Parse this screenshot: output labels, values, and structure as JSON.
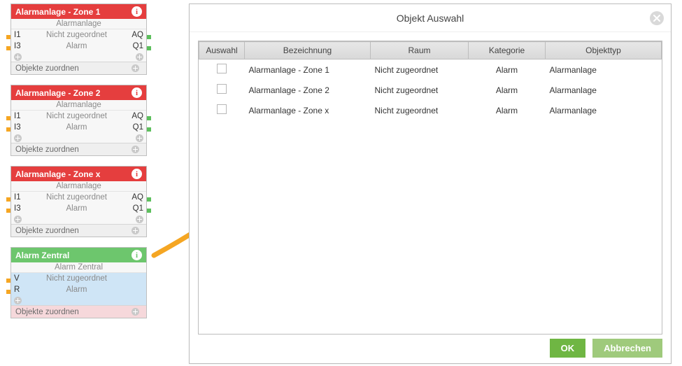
{
  "cards": [
    {
      "variant": "red",
      "title": "Alarmanlage - Zone 1",
      "subtype": "Alarmanlage",
      "rows": [
        {
          "l": "I1",
          "mid": "Nicht zugeordnet",
          "r": "AQ"
        },
        {
          "l": "I3",
          "mid": "Alarm",
          "r": "Q1"
        }
      ],
      "footer": "Objekte zuordnen"
    },
    {
      "variant": "red",
      "title": "Alarmanlage - Zone 2",
      "subtype": "Alarmanlage",
      "rows": [
        {
          "l": "I1",
          "mid": "Nicht zugeordnet",
          "r": "AQ"
        },
        {
          "l": "I3",
          "mid": "Alarm",
          "r": "Q1"
        }
      ],
      "footer": "Objekte zuordnen"
    },
    {
      "variant": "red",
      "title": "Alarmanlage - Zone x",
      "subtype": "Alarmanlage",
      "rows": [
        {
          "l": "I1",
          "mid": "Nicht zugeordnet",
          "r": "AQ"
        },
        {
          "l": "I3",
          "mid": "Alarm",
          "r": "Q1"
        }
      ],
      "footer": "Objekte zuordnen"
    },
    {
      "variant": "green",
      "title": "Alarm Zentral",
      "subtype": "Alarm Zentral",
      "rows": [
        {
          "l": "V",
          "mid": "Nicht zugeordnet",
          "r": ""
        },
        {
          "l": "R",
          "mid": "Alarm",
          "r": ""
        }
      ],
      "footer": "Objekte zuordnen"
    }
  ],
  "dialog": {
    "title": "Objekt Auswahl",
    "columns": {
      "auswahl": "Auswahl",
      "bezeichnung": "Bezeichnung",
      "raum": "Raum",
      "kategorie": "Kategorie",
      "objekttyp": "Objekttyp"
    },
    "rows": [
      {
        "bez": "Alarmanlage - Zone 1",
        "raum": "Nicht zugeordnet",
        "kat": "Alarm",
        "typ": "Alarmanlage"
      },
      {
        "bez": "Alarmanlage - Zone 2",
        "raum": "Nicht zugeordnet",
        "kat": "Alarm",
        "typ": "Alarmanlage"
      },
      {
        "bez": "Alarmanlage - Zone x",
        "raum": "Nicht zugeordnet",
        "kat": "Alarm",
        "typ": "Alarmanlage"
      }
    ],
    "buttons": {
      "ok": "OK",
      "cancel": "Abbrechen"
    }
  }
}
